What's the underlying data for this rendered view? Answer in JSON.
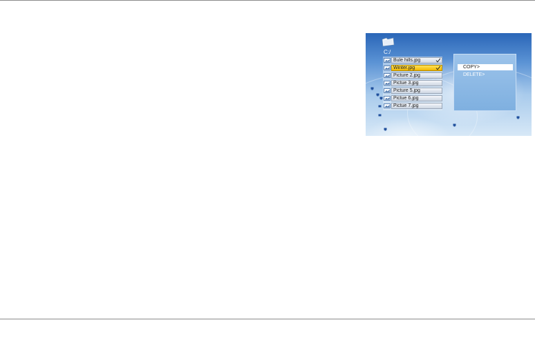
{
  "screen": {
    "path": "C:/",
    "files": [
      {
        "name": "Bule hills.jpg",
        "checked": true,
        "selected": false
      },
      {
        "name": "Winter.jpg",
        "checked": true,
        "selected": true
      },
      {
        "name": "Picture 2.jpg",
        "checked": false,
        "selected": false
      },
      {
        "name": "Pictue 3.jpg",
        "checked": false,
        "selected": false
      },
      {
        "name": "Picture 5.jpg",
        "checked": false,
        "selected": false
      },
      {
        "name": "Pictue 6.jpg",
        "checked": false,
        "selected": false
      },
      {
        "name": "Pictue 7.jpg",
        "checked": false,
        "selected": false
      }
    ],
    "menu": [
      {
        "label": "COPY>",
        "active": true
      },
      {
        "label": "DELETE>",
        "active": false
      }
    ]
  },
  "colors": {
    "selected_row": "#f2b800",
    "menu_panel": "#8cbae6"
  },
  "icons": {
    "folder": "folder-icon",
    "picture": "picture-file-icon",
    "check": "checkmark-icon",
    "desktop": "desktop-shortcut-icon"
  }
}
